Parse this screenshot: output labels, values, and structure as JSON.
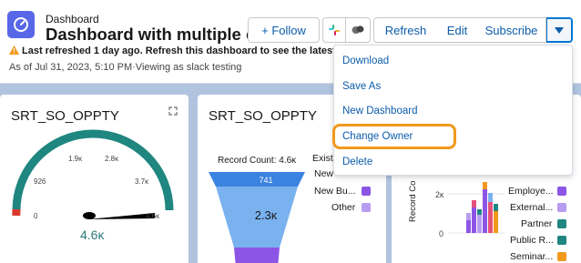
{
  "header": {
    "eyebrow": "Dashboard",
    "title": "Dashboard with multiple co...",
    "warning": "Last refreshed 1 day ago. Refresh this dashboard to see the latest data.",
    "as_of": "As of Jul 31, 2023, 5:10 PM·Viewing as slack testing"
  },
  "toolbar": {
    "follow_label": "+ Follow",
    "refresh_label": "Refresh",
    "edit_label": "Edit",
    "subscribe_label": "Subscribe"
  },
  "menu": {
    "items": [
      "Download",
      "Save As",
      "New Dashboard",
      "Change Owner",
      "Delete"
    ],
    "highlighted": "Change Owner"
  },
  "panels": {
    "gauge": {
      "title": "SRT_SO_OPPTY",
      "ticks": [
        "0",
        "926",
        "1.9κ",
        "2.8κ",
        "3.7κ",
        "4.6κ"
      ],
      "value": "4.6κ"
    },
    "funnel": {
      "title": "SRT_SO_OPPTY",
      "record_count": "Record Count: 4.6κ",
      "top_value": "741",
      "mid_value": "2.3κ",
      "legend": [
        "Exist",
        "New",
        "New Bu...",
        "Other"
      ]
    },
    "bar": {
      "y_title": "Record Co",
      "y_ticks": [
        "2κ",
        "0"
      ],
      "legend": [
        "Employe...",
        "External...",
        "Partner",
        "Public R...",
        "Seminar..."
      ]
    }
  },
  "colors": {
    "accent": "#0176d3",
    "link": "#0b5cab",
    "highlight": "#f2991d",
    "gauge": "#1f8680",
    "gauge_low": "#d9392c",
    "funnel_dark": "#3a83e0",
    "funnel_light": "#7ab1ef",
    "funnel_bottom": "#8d55e6",
    "legend": [
      "#8d55e6",
      "#8d55e6",
      "#b79cf0",
      "#1f8680",
      "#f2991d"
    ]
  }
}
